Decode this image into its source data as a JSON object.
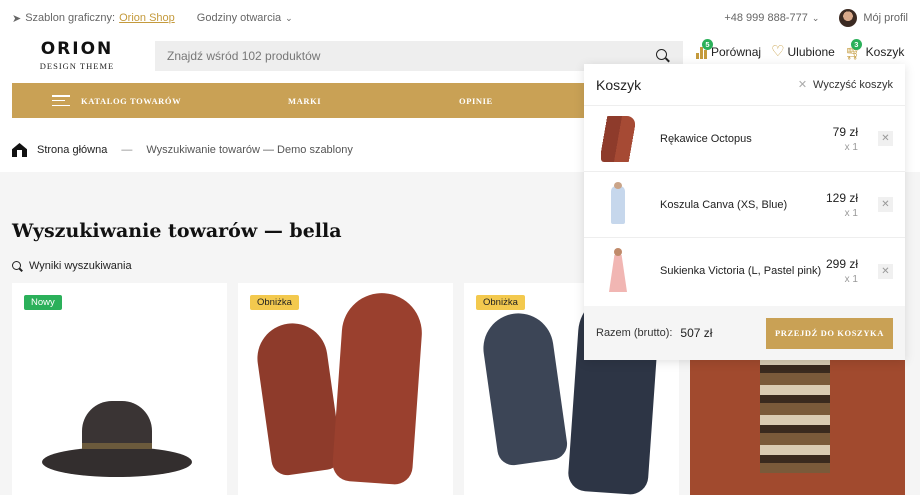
{
  "topbar": {
    "theme_prefix": "Szablon graficzny:",
    "theme_link": "Orion Shop",
    "hours": "Godziny otwarcia",
    "phone": "+48 999 888-777",
    "profile": "Mój profil"
  },
  "logo": {
    "line1": "ORION",
    "line2": "DESIGN THEME"
  },
  "search": {
    "placeholder": "Znajdź wśród 102 produktów"
  },
  "header_links": {
    "compare": {
      "label": "Porównaj",
      "count": "5"
    },
    "favorites": {
      "label": "Ulubione"
    },
    "cart": {
      "label": "Koszyk",
      "count": "3"
    }
  },
  "nav": {
    "items": [
      "KATALOG TOWARÓW",
      "MARKI",
      "OPINIE"
    ]
  },
  "breadcrumb": {
    "home": "Strona główna",
    "separator": "—",
    "current": "Wyszukiwanie towarów — Demo szablony"
  },
  "page": {
    "title": "Wyszukiwanie towarów — bella",
    "results_label": "Wyniki wyszukiwania"
  },
  "products": [
    {
      "badge": "Nowy",
      "image": "hat"
    },
    {
      "badge": "Obniżka",
      "image": "brown-gloves"
    },
    {
      "badge": "Obniżka",
      "image": "navy-gloves"
    },
    {
      "badge": "",
      "image": "scarf"
    }
  ],
  "cart_dropdown": {
    "title": "Koszyk",
    "clear_label": "Wyczyść koszyk",
    "items": [
      {
        "name": "Rękawice Octopus",
        "price": "79 zł",
        "qty": "x 1"
      },
      {
        "name": "Koszula Canva (XS, Blue)",
        "price": "129 zł",
        "qty": "x 1"
      },
      {
        "name": "Sukienka Victoria (L, Pastel pink)",
        "price": "299 zł",
        "qty": "x 1"
      }
    ],
    "total_label": "Razem (brutto):",
    "total": "507 zł",
    "checkout_label": "PRZEJDŹ DO KOSZYKA"
  },
  "colors": {
    "accent": "#c9a155",
    "badge_new": "#2bb05a",
    "badge_sale": "#f3c94e"
  }
}
